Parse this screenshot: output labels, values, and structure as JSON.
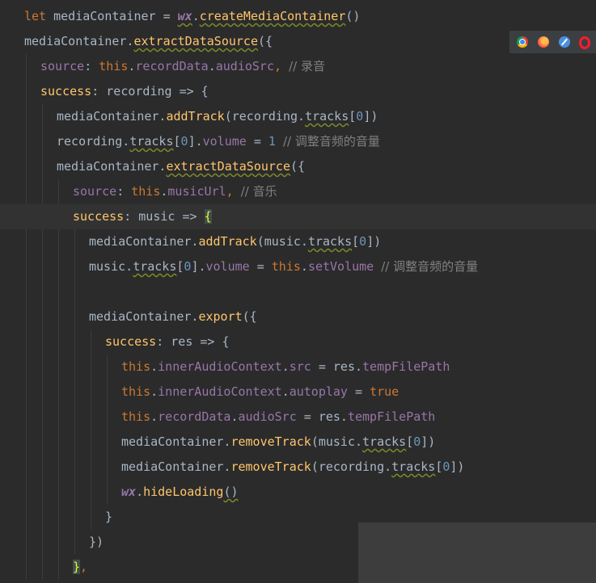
{
  "browser_bar": {
    "icons": [
      "chrome-icon",
      "firefox-icon",
      "safari-icon",
      "opera-icon"
    ]
  },
  "code": {
    "current_line": 8,
    "lines": [
      {
        "indent": 0,
        "tokens": [
          {
            "t": "let ",
            "c": "kw"
          },
          {
            "t": "mediaContainer = ",
            "c": "plain"
          },
          {
            "t": "wx",
            "c": "gl sq"
          },
          {
            "t": ".",
            "c": "plain"
          },
          {
            "t": "createMediaContainer",
            "c": "fn sq"
          },
          {
            "t": "()",
            "c": "plain"
          }
        ]
      },
      {
        "indent": 0,
        "tokens": [
          {
            "t": "mediaContainer.",
            "c": "plain"
          },
          {
            "t": "extractDataSource",
            "c": "fn sq"
          },
          {
            "t": "({",
            "c": "plain"
          }
        ]
      },
      {
        "indent": 1,
        "tokens": [
          {
            "t": "source",
            "c": "prop"
          },
          {
            "t": ": ",
            "c": "plain"
          },
          {
            "t": "this",
            "c": "kw"
          },
          {
            "t": ".",
            "c": "plain"
          },
          {
            "t": "recordData",
            "c": "prop"
          },
          {
            "t": ".",
            "c": "plain"
          },
          {
            "t": "audioSrc",
            "c": "prop"
          },
          {
            "t": ", ",
            "c": "kw"
          },
          {
            "t": "// 录音",
            "c": "cm cjk"
          }
        ]
      },
      {
        "indent": 1,
        "tokens": [
          {
            "t": "success",
            "c": "fn"
          },
          {
            "t": ": recording => {",
            "c": "plain"
          }
        ]
      },
      {
        "indent": 2,
        "tokens": [
          {
            "t": "mediaContainer.",
            "c": "plain"
          },
          {
            "t": "addTrack",
            "c": "fn"
          },
          {
            "t": "(recording.",
            "c": "plain"
          },
          {
            "t": "tracks",
            "c": "plain sq"
          },
          {
            "t": "[",
            "c": "plain"
          },
          {
            "t": "0",
            "c": "num"
          },
          {
            "t": "])",
            "c": "plain"
          }
        ]
      },
      {
        "indent": 2,
        "tokens": [
          {
            "t": "recording.",
            "c": "plain"
          },
          {
            "t": "tracks",
            "c": "plain sq"
          },
          {
            "t": "[",
            "c": "plain"
          },
          {
            "t": "0",
            "c": "num"
          },
          {
            "t": "].",
            "c": "plain"
          },
          {
            "t": "volume",
            "c": "prop"
          },
          {
            "t": " = ",
            "c": "plain"
          },
          {
            "t": "1",
            "c": "num"
          },
          {
            "t": " ",
            "c": "plain"
          },
          {
            "t": "// 调整音频的音量",
            "c": "cm cjk"
          }
        ]
      },
      {
        "indent": 2,
        "tokens": [
          {
            "t": "mediaContainer.",
            "c": "plain"
          },
          {
            "t": "extractDataSource",
            "c": "fn sq"
          },
          {
            "t": "({",
            "c": "plain"
          }
        ]
      },
      {
        "indent": 3,
        "tokens": [
          {
            "t": "source",
            "c": "prop"
          },
          {
            "t": ": ",
            "c": "plain"
          },
          {
            "t": "this",
            "c": "kw"
          },
          {
            "t": ".",
            "c": "plain"
          },
          {
            "t": "musicUrl",
            "c": "prop"
          },
          {
            "t": ", ",
            "c": "kw"
          },
          {
            "t": "// 音乐",
            "c": "cm cjk"
          }
        ]
      },
      {
        "indent": 3,
        "tokens": [
          {
            "t": "success",
            "c": "fn"
          },
          {
            "t": ": music => ",
            "c": "plain"
          },
          {
            "t": "{",
            "c": "bm"
          }
        ]
      },
      {
        "indent": 4,
        "tokens": [
          {
            "t": "mediaContainer.",
            "c": "plain"
          },
          {
            "t": "addTrack",
            "c": "fn"
          },
          {
            "t": "(music.",
            "c": "plain"
          },
          {
            "t": "tracks",
            "c": "plain sq"
          },
          {
            "t": "[",
            "c": "plain"
          },
          {
            "t": "0",
            "c": "num"
          },
          {
            "t": "])",
            "c": "plain"
          }
        ]
      },
      {
        "indent": 4,
        "tokens": [
          {
            "t": "music.",
            "c": "plain"
          },
          {
            "t": "tracks",
            "c": "plain sq"
          },
          {
            "t": "[",
            "c": "plain"
          },
          {
            "t": "0",
            "c": "num"
          },
          {
            "t": "].",
            "c": "plain"
          },
          {
            "t": "volume",
            "c": "prop"
          },
          {
            "t": " = ",
            "c": "plain"
          },
          {
            "t": "this",
            "c": "kw"
          },
          {
            "t": ".",
            "c": "plain"
          },
          {
            "t": "setVolume",
            "c": "prop"
          },
          {
            "t": " ",
            "c": "plain"
          },
          {
            "t": "// 调整音频的音量",
            "c": "cm cjk"
          }
        ]
      },
      {
        "indent": 4,
        "tokens": []
      },
      {
        "indent": 4,
        "tokens": [
          {
            "t": "mediaContainer.",
            "c": "plain"
          },
          {
            "t": "export",
            "c": "fn"
          },
          {
            "t": "({",
            "c": "plain"
          }
        ]
      },
      {
        "indent": 5,
        "tokens": [
          {
            "t": "success",
            "c": "fn"
          },
          {
            "t": ": res => {",
            "c": "plain"
          }
        ]
      },
      {
        "indent": 6,
        "tokens": [
          {
            "t": "this",
            "c": "kw"
          },
          {
            "t": ".",
            "c": "plain"
          },
          {
            "t": "innerAudioContext",
            "c": "prop"
          },
          {
            "t": ".",
            "c": "plain"
          },
          {
            "t": "src",
            "c": "prop"
          },
          {
            "t": " = res.",
            "c": "plain"
          },
          {
            "t": "tempFilePath",
            "c": "prop"
          }
        ]
      },
      {
        "indent": 6,
        "tokens": [
          {
            "t": "this",
            "c": "kw"
          },
          {
            "t": ".",
            "c": "plain"
          },
          {
            "t": "innerAudioContext",
            "c": "prop"
          },
          {
            "t": ".",
            "c": "plain"
          },
          {
            "t": "autoplay",
            "c": "prop"
          },
          {
            "t": " = ",
            "c": "plain"
          },
          {
            "t": "true",
            "c": "kw"
          }
        ]
      },
      {
        "indent": 6,
        "tokens": [
          {
            "t": "this",
            "c": "kw"
          },
          {
            "t": ".",
            "c": "plain"
          },
          {
            "t": "recordData",
            "c": "prop"
          },
          {
            "t": ".",
            "c": "plain"
          },
          {
            "t": "audioSrc",
            "c": "prop"
          },
          {
            "t": " = res.",
            "c": "plain"
          },
          {
            "t": "tempFilePath",
            "c": "prop"
          }
        ]
      },
      {
        "indent": 6,
        "tokens": [
          {
            "t": "mediaContainer.",
            "c": "plain"
          },
          {
            "t": "removeTrack",
            "c": "fn"
          },
          {
            "t": "(music.",
            "c": "plain"
          },
          {
            "t": "tracks",
            "c": "plain sq"
          },
          {
            "t": "[",
            "c": "plain"
          },
          {
            "t": "0",
            "c": "num"
          },
          {
            "t": "])",
            "c": "plain"
          }
        ]
      },
      {
        "indent": 6,
        "tokens": [
          {
            "t": "mediaContainer.",
            "c": "plain"
          },
          {
            "t": "removeTrack",
            "c": "fn"
          },
          {
            "t": "(recording.",
            "c": "plain"
          },
          {
            "t": "tracks",
            "c": "plain sq"
          },
          {
            "t": "[",
            "c": "plain"
          },
          {
            "t": "0",
            "c": "num"
          },
          {
            "t": "])",
            "c": "plain"
          }
        ]
      },
      {
        "indent": 6,
        "tokens": [
          {
            "t": "wx",
            "c": "gl"
          },
          {
            "t": ".",
            "c": "plain"
          },
          {
            "t": "hideLoading",
            "c": "fn"
          },
          {
            "t": "()",
            "c": "plain sq"
          }
        ]
      },
      {
        "indent": 5,
        "tokens": [
          {
            "t": "}",
            "c": "plain"
          }
        ]
      },
      {
        "indent": 4,
        "tokens": [
          {
            "t": "})",
            "c": "plain"
          }
        ]
      },
      {
        "indent": 3,
        "tokens": [
          {
            "t": "}",
            "c": "bm"
          },
          {
            "t": ",",
            "c": "kw"
          }
        ]
      }
    ]
  }
}
